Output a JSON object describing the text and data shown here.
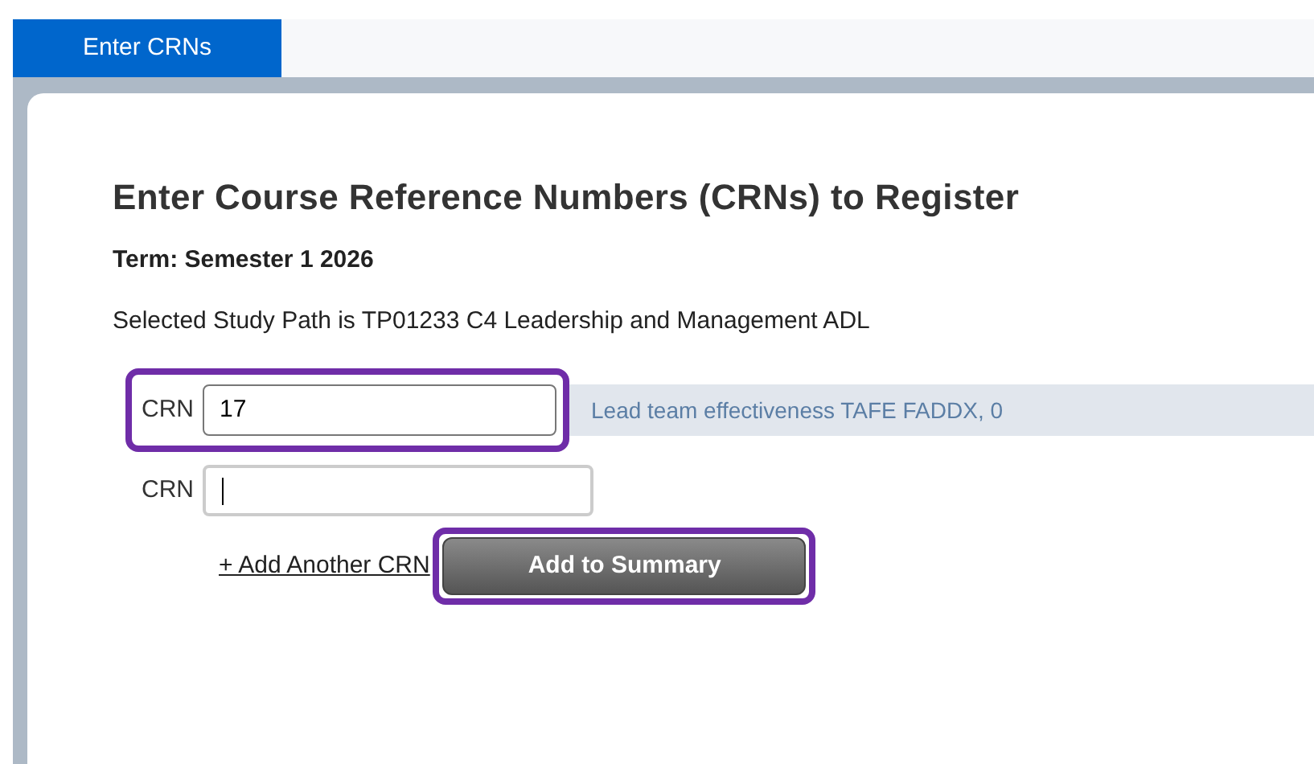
{
  "tabs": [
    {
      "label": "Enter CRNs",
      "selected": true
    }
  ],
  "heading": "Enter Course Reference Numbers (CRNs) to Register",
  "term": "Term: Semester 1 2026",
  "study_path": "Selected Study Path is TP01233 C4 Leadership and Management ADL",
  "crn_rows": [
    {
      "label": "CRN",
      "value": "17",
      "description": "Lead team effectiveness TAFE FADDX, 0",
      "focused": false,
      "highlighted": true
    },
    {
      "label": "CRN",
      "value": "",
      "focused": true,
      "highlighted": false
    }
  ],
  "add_link": "+ Add Another CRN",
  "submit": {
    "label": "Add to Summary",
    "highlighted": true
  }
}
